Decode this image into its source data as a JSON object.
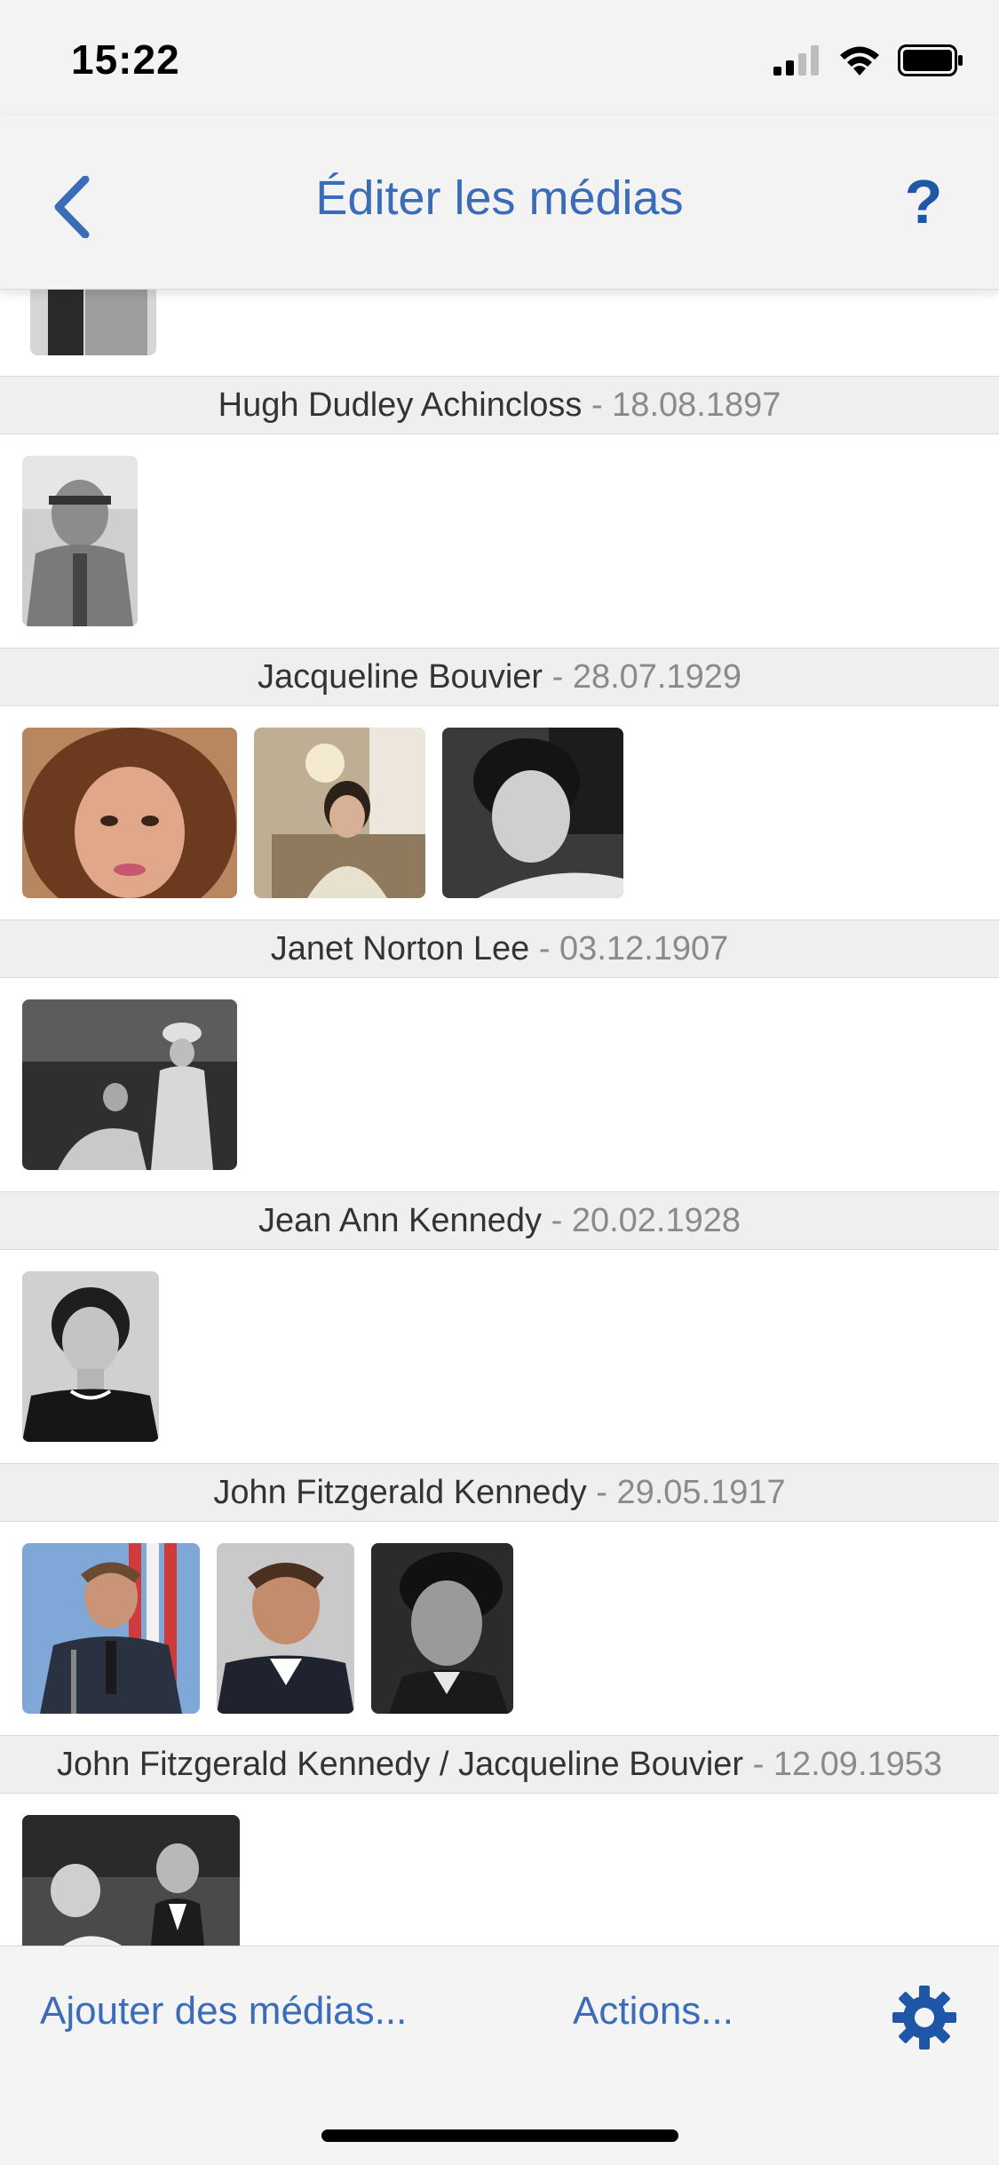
{
  "status_bar": {
    "time": "15:22",
    "signal": "signal-icon",
    "wifi": "wifi-icon",
    "battery": "battery-icon"
  },
  "nav": {
    "title": "Éditer les médias",
    "help": "?",
    "back_icon": "chevron-left-icon"
  },
  "sections": [
    {
      "name": "Hugh Dudley Achincloss",
      "date": " - 18.08.1897",
      "photos": 1
    },
    {
      "name": "Jacqueline Bouvier",
      "date": " - 28.07.1929",
      "photos": 3
    },
    {
      "name": "Janet Norton Lee",
      "date": " - 03.12.1907",
      "photos": 1
    },
    {
      "name": "Jean Ann Kennedy",
      "date": " - 20.02.1928",
      "photos": 1
    },
    {
      "name": "John Fitzgerald Kennedy",
      "date": " - 29.05.1917",
      "photos": 3
    },
    {
      "name": "John Fitzgerald Kennedy / Jacqueline Bouvier",
      "date": " - 12.09.1953",
      "photos": 1
    }
  ],
  "bottom_bar": {
    "add_media": "Ajouter des médias...",
    "actions": "Actions...",
    "settings_icon": "gear-icon"
  },
  "colors": {
    "accent": "#3b6cb7",
    "header_bg": "#efefef",
    "date_gray": "#8a8a8a"
  }
}
